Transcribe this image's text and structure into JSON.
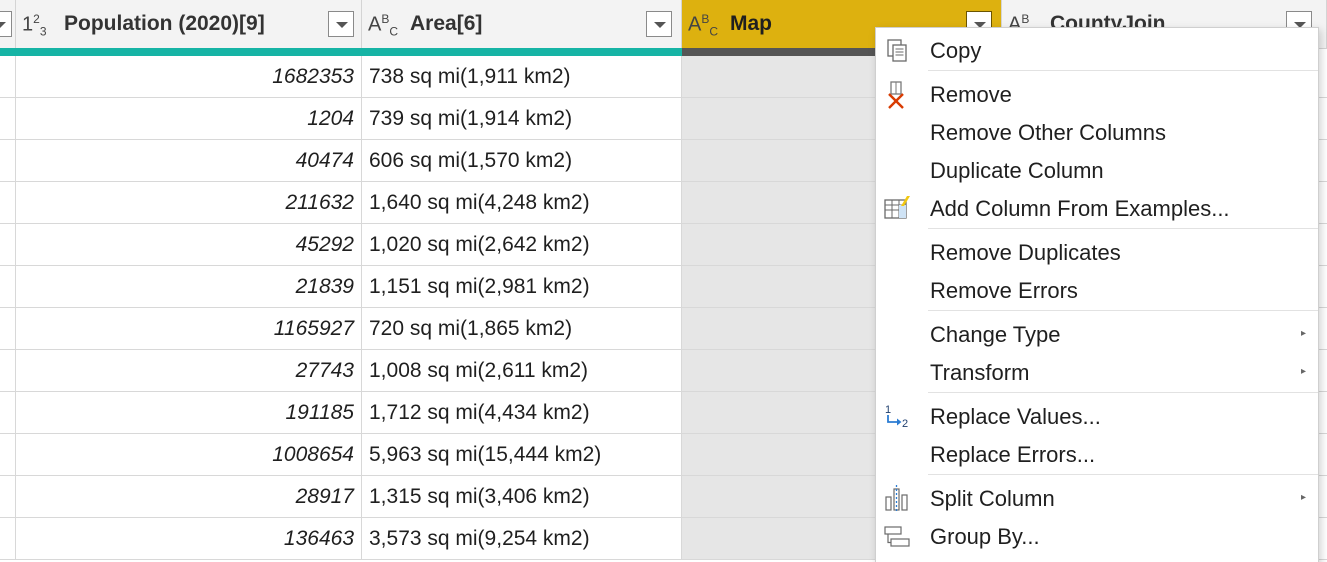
{
  "columns": [
    {
      "type": "",
      "title": ""
    },
    {
      "type": "1²3",
      "title": "Population (2020)[9]"
    },
    {
      "type": "ABC",
      "title": "Area[6]"
    },
    {
      "type": "ABC",
      "title": "Map"
    },
    {
      "type": "AB",
      "title": "CountyJoin"
    }
  ],
  "rows": [
    {
      "population": "1682353",
      "area": "738 sq mi(1,911 km2)"
    },
    {
      "population": "1204",
      "area": "739 sq mi(1,914 km2)"
    },
    {
      "population": "40474",
      "area": "606 sq mi(1,570 km2)"
    },
    {
      "population": "211632",
      "area": "1,640 sq mi(4,248 km2)"
    },
    {
      "population": "45292",
      "area": "1,020 sq mi(2,642 km2)"
    },
    {
      "population": "21839",
      "area": "1,151 sq mi(2,981 km2)"
    },
    {
      "population": "1165927",
      "area": "720 sq mi(1,865 km2)"
    },
    {
      "population": "27743",
      "area": "1,008 sq mi(2,611 km2)"
    },
    {
      "population": "191185",
      "area": "1,712 sq mi(4,434 km2)"
    },
    {
      "population": "1008654",
      "area": "5,963 sq mi(15,444 km2)"
    },
    {
      "population": "28917",
      "area": "1,315 sq mi(3,406 km2)"
    },
    {
      "population": "136463",
      "area": "3,573 sq mi(9,254 km2)"
    }
  ],
  "menu": {
    "copy": "Copy",
    "remove": "Remove",
    "remove_other_columns": "Remove Other Columns",
    "duplicate_column": "Duplicate Column",
    "add_column_from_examples": "Add Column From Examples...",
    "remove_duplicates": "Remove Duplicates",
    "remove_errors": "Remove Errors",
    "change_type": "Change Type",
    "transform": "Transform",
    "replace_values": "Replace Values...",
    "replace_errors": "Replace Errors...",
    "split_column": "Split Column",
    "group_by": "Group By..."
  },
  "colors": {
    "selected_header": "#ddb10f",
    "quality_bar": "#16b4a5",
    "remove_x": "#d83b01"
  }
}
